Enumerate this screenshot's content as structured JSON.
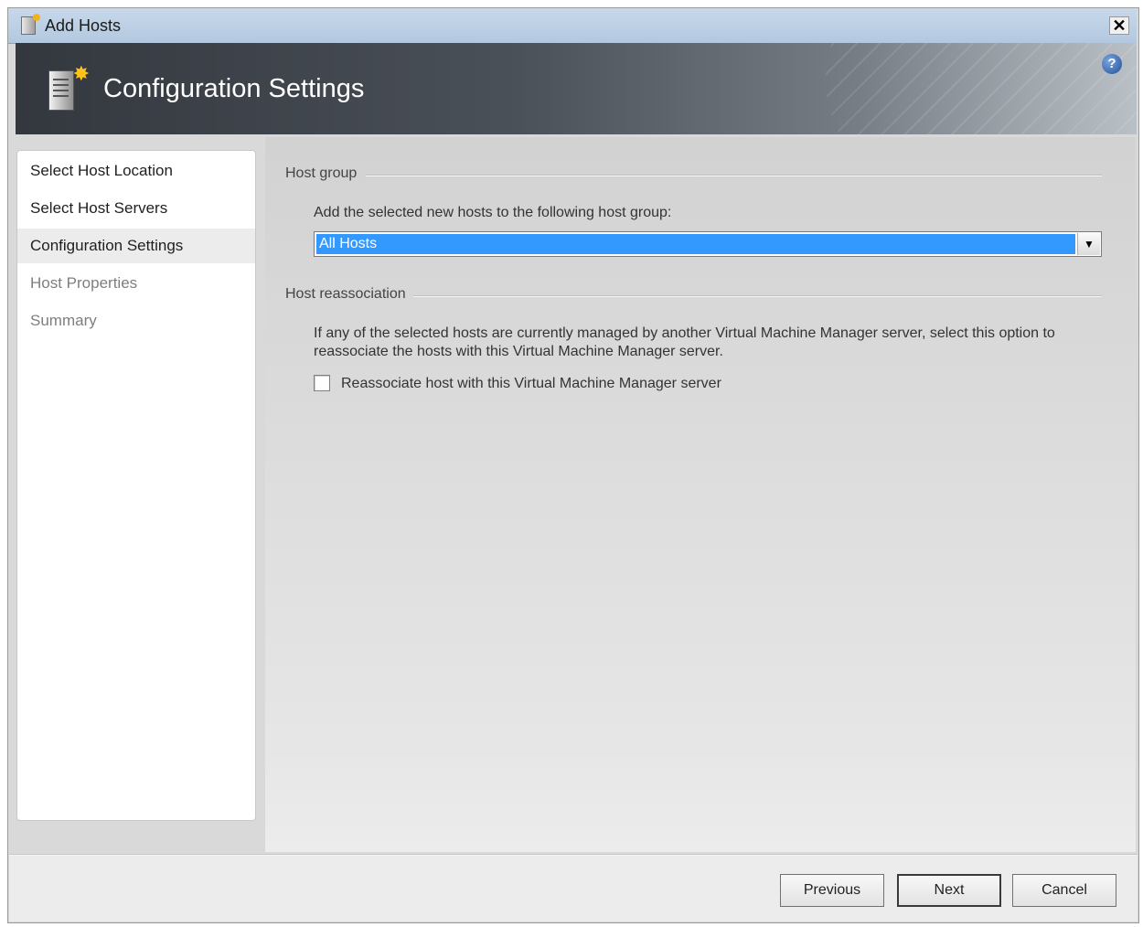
{
  "window": {
    "title": "Add Hosts",
    "close_label": "✕"
  },
  "header": {
    "title": "Configuration Settings",
    "help_label": "?"
  },
  "nav": {
    "items": [
      {
        "label": "Select Host Location",
        "state": "completed"
      },
      {
        "label": "Select Host Servers",
        "state": "completed"
      },
      {
        "label": "Configuration Settings",
        "state": "active"
      },
      {
        "label": "Host Properties",
        "state": "disabled"
      },
      {
        "label": "Summary",
        "state": "disabled"
      }
    ]
  },
  "host_group": {
    "section_label": "Host group",
    "prompt": "Add the selected new hosts to the following host group:",
    "selected_value": "All Hosts"
  },
  "host_reassociation": {
    "section_label": "Host reassociation",
    "description_line1": "If any of the selected hosts are currently managed by another Virtual Machine Manager server, select this option to",
    "description_line2": "reassociate the hosts with this Virtual Machine Manager server.",
    "checkbox_label": "Reassociate host with this Virtual Machine Manager server",
    "checked": false
  },
  "footer": {
    "previous_label": "Previous",
    "next_label": "Next",
    "cancel_label": "Cancel"
  }
}
